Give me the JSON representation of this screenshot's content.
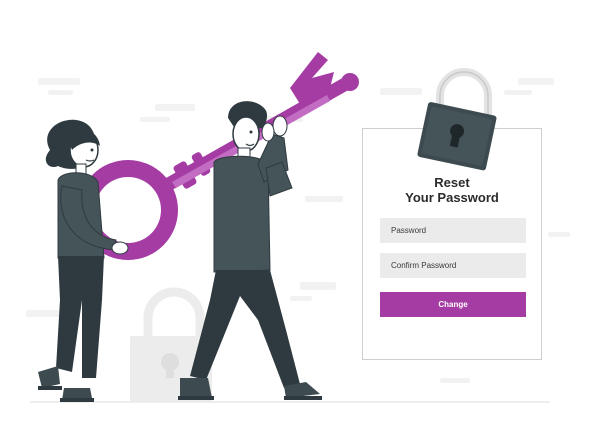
{
  "card": {
    "title_line1": "Reset",
    "title_line2": "Your Password",
    "password_placeholder": "Password",
    "confirm_placeholder": "Confirm Password",
    "button_label": "Change"
  },
  "colors": {
    "accent": "#a43ca4",
    "dark": "#2f3a40",
    "shirt": "#455459",
    "lock": "#3d4a50",
    "shackle": "#e3e3e3"
  }
}
